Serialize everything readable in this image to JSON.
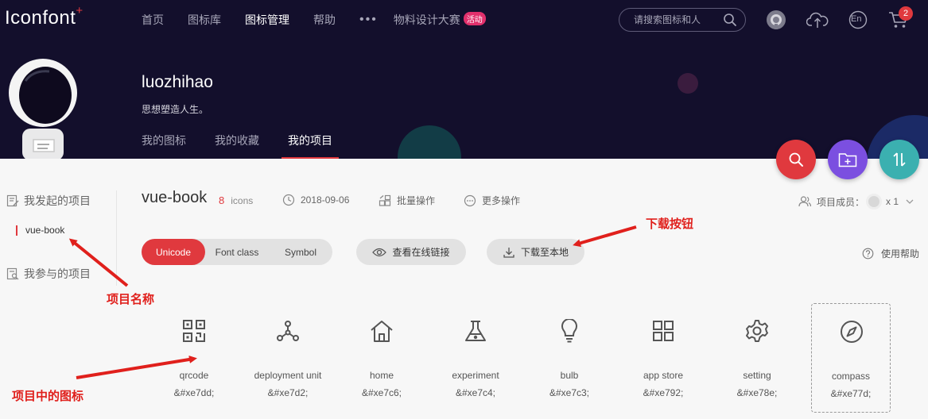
{
  "header": {
    "logo_text": "Iconfont",
    "logo_mark": "+",
    "nav": [
      "首页",
      "图标库",
      "图标管理",
      "帮助"
    ],
    "nav_more": "•••",
    "nav_event": "物料设计大赛",
    "nav_event_badge": "活动",
    "search_placeholder": "请搜索图标和人",
    "lang_label": "En",
    "cart_count": "2"
  },
  "profile": {
    "username": "luozhihao",
    "motto": "思想塑造人生。",
    "tabs": [
      "我的图标",
      "我的收藏",
      "我的项目"
    ]
  },
  "sidebar": {
    "created_heading": "我发起的项目",
    "project_item": "vue-book",
    "joined_heading": "我参与的项目"
  },
  "project": {
    "name": "vue-book",
    "icon_count": "8",
    "icon_count_unit": "icons",
    "date": "2018-09-06",
    "batch_label": "批量操作",
    "more_label": "更多操作",
    "members_label": "项目成员：",
    "members_count": "x 1"
  },
  "toolbar": {
    "modes": [
      "Unicode",
      "Font class",
      "Symbol"
    ],
    "online_link_label": "查看在线链接",
    "download_label": "下载至本地",
    "help_label": "使用帮助"
  },
  "icons": [
    {
      "name": "qrcode",
      "code": "&#xe7dd;"
    },
    {
      "name": "deployment unit",
      "code": "&#xe7d2;"
    },
    {
      "name": "home",
      "code": "&#xe7c6;"
    },
    {
      "name": "experiment",
      "code": "&#xe7c4;"
    },
    {
      "name": "bulb",
      "code": "&#xe7c3;"
    },
    {
      "name": "app store",
      "code": "&#xe792;"
    },
    {
      "name": "setting",
      "code": "&#xe78e;"
    },
    {
      "name": "compass",
      "code": "&#xe77d;"
    }
  ],
  "annotations": {
    "download_button": "下载按钮",
    "project_name": "项目名称",
    "project_icons": "项目中的图标"
  },
  "colors": {
    "header_bg": "#130f2c",
    "accent_red": "#e0393e",
    "fab_search": "#e0393e",
    "fab_folder": "#7b4fe0",
    "fab_sort": "#3bb0b0",
    "annotation_red": "#e0201c"
  }
}
